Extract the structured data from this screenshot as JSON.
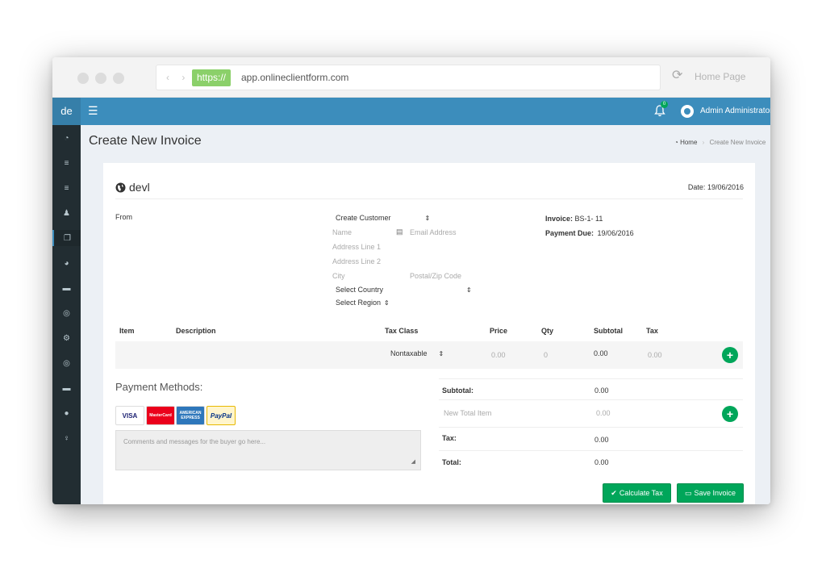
{
  "browser": {
    "nav_arrows": "‹ ›",
    "https_label": "https://",
    "url": "app.onlineclientform.com",
    "home_page": "Home Page"
  },
  "header": {
    "brand": "de",
    "menu_icon": "☰",
    "notifications_count": "0",
    "user_name": "Admin Administrator"
  },
  "sidebar": {
    "items": [
      {
        "icon": "dashboard-icon",
        "glyph": "◔"
      },
      {
        "icon": "list-icon",
        "glyph": "≡"
      },
      {
        "icon": "list-icon",
        "glyph": "≡"
      },
      {
        "icon": "users-icon",
        "glyph": "♟"
      },
      {
        "icon": "copy-icon",
        "glyph": "❐"
      },
      {
        "icon": "pie-chart-icon",
        "glyph": "◕"
      },
      {
        "icon": "book-icon",
        "glyph": "▬"
      },
      {
        "icon": "support-icon",
        "glyph": "◎"
      },
      {
        "icon": "cogs-icon",
        "glyph": "⚙"
      },
      {
        "icon": "support-icon",
        "glyph": "◎"
      },
      {
        "icon": "book-icon",
        "glyph": "▬"
      },
      {
        "icon": "comments-icon",
        "glyph": "●"
      },
      {
        "icon": "lightbulb-icon",
        "glyph": "♀"
      }
    ]
  },
  "page": {
    "title": "Create New Invoice",
    "breadcrumb_home": "Home",
    "breadcrumb_sep": "›",
    "breadcrumb_current": "Create New Invoice"
  },
  "invoice": {
    "company": "devl",
    "date_label": "Date:",
    "date_value": "19/06/2016",
    "from_label": "From",
    "customer_select": "Create Customer",
    "name_placeholder": "Name",
    "email_placeholder": "Email Address",
    "address1_placeholder": "Address Line 1",
    "address2_placeholder": "Address Line 2",
    "city_placeholder": "City",
    "postal_placeholder": "Postal/Zip Code",
    "country_select": "Select Country",
    "region_select": "Select Region",
    "invoice_label": "Invoice:",
    "invoice_number": "BS-1- 11",
    "payment_due_label": "Payment Due:",
    "payment_due_value": "19/06/2016"
  },
  "items_table": {
    "headers": {
      "item": "Item",
      "description": "Description",
      "tax_class": "Tax Class",
      "price": "Price",
      "qty": "Qty",
      "subtotal": "Subtotal",
      "tax": "Tax"
    },
    "row": {
      "tax_class": "Nontaxable",
      "price": "0.00",
      "qty": "0",
      "subtotal": "0.00",
      "tax": "0.00"
    }
  },
  "payment": {
    "title": "Payment Methods:",
    "cards": [
      {
        "name": "visa-card",
        "label": "VISA",
        "color": "#1a1f71",
        "bg": "#ffffff"
      },
      {
        "name": "mastercard-card",
        "label": "MasterCard",
        "color": "#ffffff",
        "bg": "#eb001b"
      },
      {
        "name": "amex-card",
        "label": "AMERICAN EXPRESS",
        "color": "#ffffff",
        "bg": "#2e77bb"
      },
      {
        "name": "paypal-card",
        "label": "PayPal",
        "color": "#003087",
        "bg": "#fff5cc"
      }
    ],
    "comments_placeholder": "Comments and messages for the buyer go here..."
  },
  "totals": {
    "subtotal_label": "Subtotal:",
    "subtotal_value": "0.00",
    "new_total_placeholder": "New Total Item",
    "new_total_value": "0.00",
    "tax_label": "Tax:",
    "tax_value": "0.00",
    "total_label": "Total:",
    "total_value": "0.00"
  },
  "buttons": {
    "calculate_tax": "Calculate Tax",
    "save_invoice": "Save Invoice",
    "add": "+"
  },
  "colors": {
    "primary": "#3c8dbc",
    "sidebar": "#222d32",
    "success": "#00a65a",
    "https_badge": "#8bd06a"
  }
}
